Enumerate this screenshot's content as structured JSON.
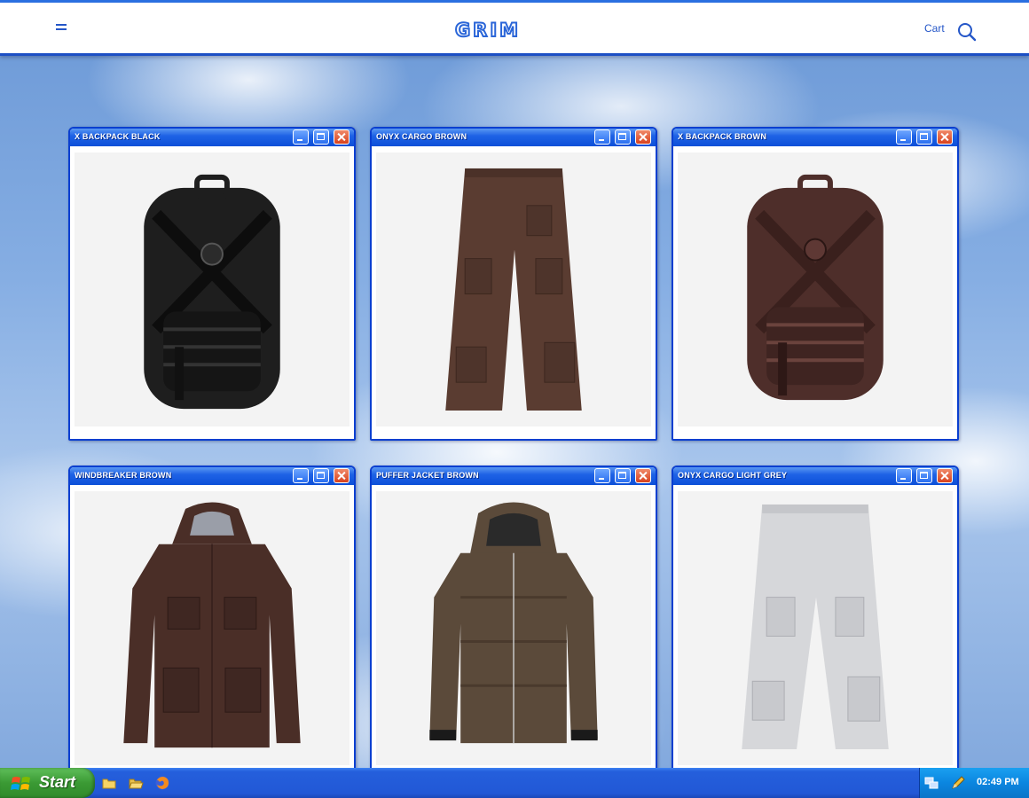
{
  "header": {
    "brand": "GRIM",
    "cart_label": "Cart",
    "menu_icon": "hamburger-icon",
    "search_icon": "search-icon",
    "accent_color": "#2456c8"
  },
  "products": [
    {
      "title": "X BACKPACK BLACK",
      "image": "black-backpack",
      "color": "#1f1f1f"
    },
    {
      "title": "ONYX CARGO BROWN",
      "image": "brown-cargo-pants",
      "color": "#5a3c31"
    },
    {
      "title": "X BACKPACK BROWN",
      "image": "brown-backpack",
      "color": "#4e2e2a"
    },
    {
      "title": "WINDBREAKER BROWN",
      "image": "brown-windbreaker",
      "color": "#4a2e27"
    },
    {
      "title": "PUFFER JACKET BROWN",
      "image": "brown-puffer-jacket",
      "color": "#5b4a3a"
    },
    {
      "title": "ONYX CARGO LIGHT GREY",
      "image": "light-grey-cargo-pants",
      "color": "#d6d7da"
    }
  ],
  "taskbar": {
    "start_label": "Start",
    "clock": "02:49 PM",
    "quick_launch": [
      "folder-icon",
      "folder-open-icon",
      "firefox-icon"
    ],
    "tray_icons": [
      "network-icon",
      "pencil-icon"
    ]
  }
}
